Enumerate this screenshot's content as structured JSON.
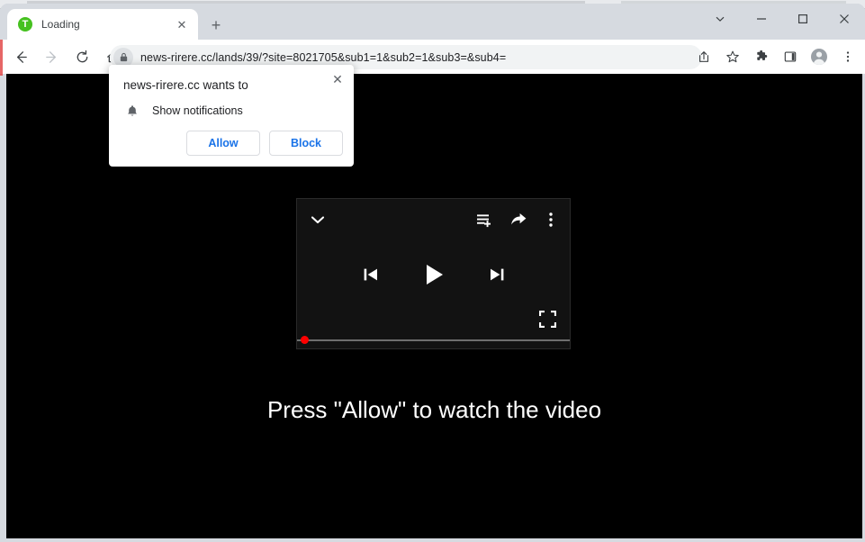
{
  "window": {
    "controls": [
      {
        "name": "tab-search-button",
        "icon": "chevron-down-icon",
        "label": "⌄"
      },
      {
        "name": "minimize-button",
        "icon": "minimize-icon",
        "label": "—"
      },
      {
        "name": "maximize-button",
        "icon": "maximize-icon",
        "label": "□"
      },
      {
        "name": "close-button",
        "icon": "close-icon",
        "label": "✕"
      }
    ]
  },
  "tab": {
    "title": "Loading",
    "favicon_letter": "T",
    "favicon_color": "#45c11f",
    "close_label": "✕",
    "new_tab_label": "+"
  },
  "toolbar": {
    "back_label": "←",
    "forward_label": "→",
    "reload_label": "↻",
    "home_label": "⌂",
    "url": "news-rirere.cc/lands/39/?site=8021705&sub1=1&sub2=1&sub3=&sub4=",
    "lock_icon": "lock-icon",
    "right_icons": [
      {
        "name": "share-page-icon",
        "label": "share"
      },
      {
        "name": "bookmark-star-icon",
        "label": "star"
      },
      {
        "name": "extensions-puzzle-icon",
        "label": "puzzle"
      },
      {
        "name": "side-panel-icon",
        "label": "panel"
      },
      {
        "name": "profile-avatar-icon",
        "label": "profile"
      },
      {
        "name": "browser-menu-icon",
        "label": "menu"
      }
    ]
  },
  "permission_dialog": {
    "title": "news-rirere.cc wants to",
    "permission_label": "Show notifications",
    "permission_icon": "bell-icon",
    "allow_label": "Allow",
    "block_label": "Block",
    "close_label": "✕",
    "accent_color": "#1a73e8"
  },
  "player": {
    "chevron_icon": "chevron-down-icon",
    "queue_icon": "add-to-queue-icon",
    "share_icon": "share-arrow-icon",
    "more_icon": "more-options-kebab-icon",
    "previous_icon": "previous-track-icon",
    "play_icon": "play-icon",
    "next_icon": "next-track-icon",
    "fullscreen_icon": "fullscreen-icon",
    "progress_percent": 0,
    "scrubber_color": "#ff0000",
    "background_color": "#121212"
  },
  "page": {
    "headline": "Press \"Allow\" to watch the video",
    "background_color": "#000000"
  }
}
